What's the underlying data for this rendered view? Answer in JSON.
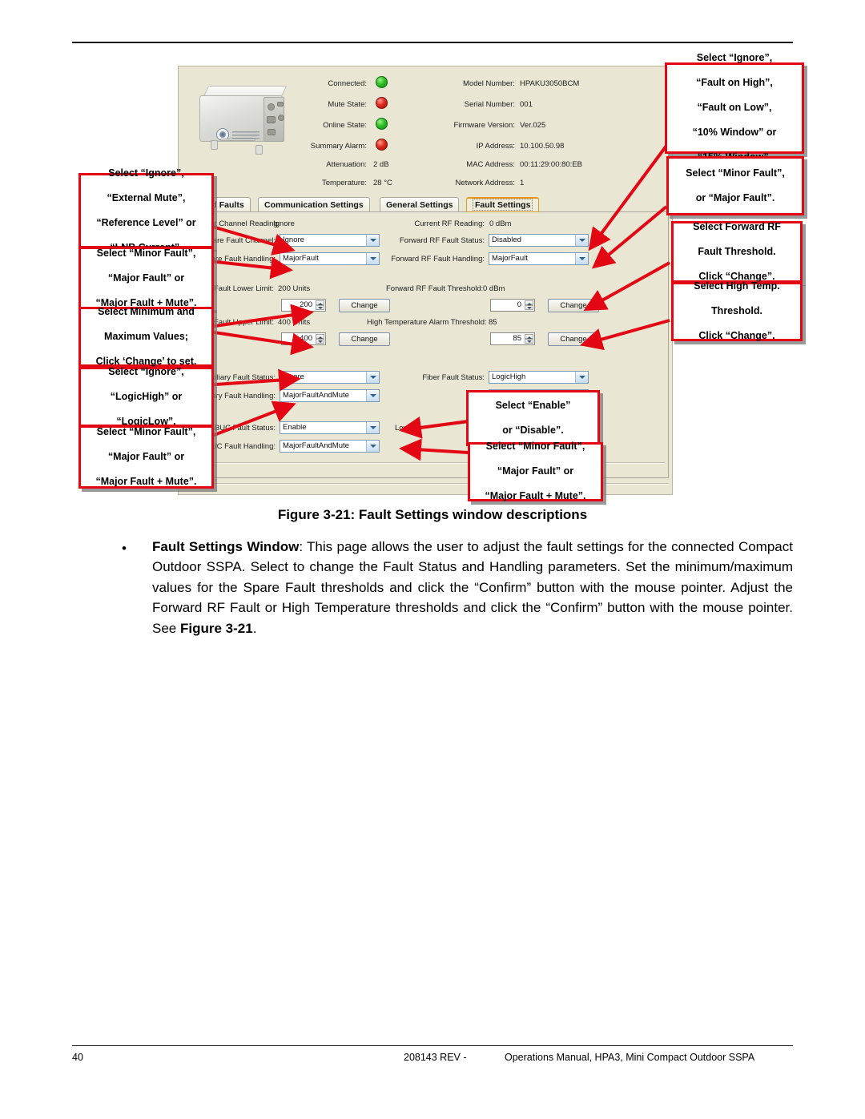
{
  "page": {
    "number": "40",
    "doc_number": "208143 REV -",
    "manual": "Operations Manual, HPA3, Mini Compact Outdoor SSPA"
  },
  "caption": "Figure 3-21: Fault Settings window descriptions",
  "body": {
    "lead": "Fault Settings Window",
    "text": ": This page allows the user to adjust the fault settings for the connected Compact Outdoor SSPA. Select to change the Fault Status and Handling parameters. Set the minimum/maximum values for the Spare Fault thresholds and click the “Confirm” button with the mouse pointer. Adjust the Forward RF Fault or High Temperature thresholds and click the “Confirm” button with the mouse pointer. See ",
    "see_figure": "Figure 3-21",
    "period": "."
  },
  "app": {
    "status_left": [
      {
        "label": "Connected:",
        "type": "led",
        "value": "green"
      },
      {
        "label": "Mute State:",
        "type": "led",
        "value": "red"
      },
      {
        "label": "Online State:",
        "type": "led",
        "value": "green"
      },
      {
        "label": "Summary Alarm:",
        "type": "led",
        "value": "red"
      },
      {
        "label": "Attenuation:",
        "type": "text",
        "value": "2 dB"
      },
      {
        "label": "Temperature:",
        "type": "text",
        "value": "28 °C"
      }
    ],
    "status_right": [
      {
        "label": "Model Number:",
        "value": "HPAKU3050BCM"
      },
      {
        "label": "Serial Number:",
        "value": "001"
      },
      {
        "label": "Firmware Version:",
        "value": "Ver.025"
      },
      {
        "label": "IP Address:",
        "value": "10.100.50.98"
      },
      {
        "label": "MAC Address:",
        "value": "00:11:29:00:80:EB"
      },
      {
        "label": "Network Address:",
        "value": "1"
      }
    ],
    "tabs": [
      {
        "label": "us and Faults",
        "selected": false
      },
      {
        "label": "Communication Settings",
        "selected": false
      },
      {
        "label": "General Settings",
        "selected": false
      },
      {
        "label": "Fault Settings",
        "selected": true
      }
    ],
    "fault_settings": {
      "left": {
        "current_channel_reading_label": "Current Channel Reading:",
        "current_channel_reading_value": "Ignore",
        "spare_fault_channel_label": "Spare Fault Channel:",
        "spare_fault_channel_value": "Ignore",
        "spare_fault_handling_label": "Spare Fault Handling:",
        "spare_fault_handling_value": "MajorFault",
        "spare_lower_label": "Spare Fault Lower Limit:",
        "spare_lower_value": "200 Units",
        "spare_lower_spin": "200",
        "spare_lower_button": "Change",
        "spare_upper_label": "Spare Fault Upper Limit:",
        "spare_upper_value": "400 Units",
        "spare_upper_spin": "400",
        "spare_upper_button": "Change",
        "aux_status_label": "Auxiliary Fault Status:",
        "aux_status_value": "Ignore",
        "aux_handling_label": "Auxiliary Fault Handling:",
        "aux_handling_value": "MajorFaultAndMute",
        "buc_status_label": "BUC Fault Status:",
        "buc_status_value": "Enable",
        "buc_handling_label": "BUC Fault Handling:",
        "buc_handling_value": "MajorFaultAndMute"
      },
      "right": {
        "current_rf_label": "Current RF Reading:",
        "current_rf_value": "0 dBm",
        "fwd_status_label": "Forward RF Fault Status:",
        "fwd_status_value": "Disabled",
        "fwd_handling_label": "Forward RF Fault Handling:",
        "fwd_handling_value": "MajorFault",
        "fwd_threshold_label": "Forward RF Fault Threshold:",
        "fwd_threshold_value": "0 dBm",
        "fwd_threshold_spin": "0",
        "fwd_threshold_button": "Change",
        "high_temp_label": "High Temperature Alarm Threshold:",
        "high_temp_value": "85",
        "high_temp_spin": "85",
        "high_temp_button": "Change",
        "fiber_status_label": "Fiber Fault Status:",
        "fiber_status_value": "LogicHigh",
        "low_current_label": "Low Cu"
      }
    }
  },
  "callouts": {
    "c1": "Select “Ignore”, “Fault on High”, “Fault on Low”, “10% Window” or “15% Window”.",
    "c1_lines": [
      "Select “Ignore”,",
      "“Fault on High”,",
      "“Fault on Low”,",
      "“10% Window” or",
      "“15% Window”."
    ],
    "c2_lines": [
      "Select “Minor Fault”,",
      "or “Major Fault”."
    ],
    "c3_lines": [
      "Select Forward RF",
      "Fault Threshold.",
      "Click “Change”."
    ],
    "c4_lines": [
      "Select High Temp.",
      "Threshold.",
      "Click “Change”."
    ],
    "c5_lines": [
      "Select “Ignore”,",
      "“External Mute”,",
      "“Reference Level” or",
      "“LNB Current”."
    ],
    "c6_lines": [
      "Select “Minor Fault”,",
      "“Major Fault” or",
      "“Major Fault + Mute”."
    ],
    "c7_lines": [
      "Select Minimum and",
      "Maximum Values;",
      "Click ‘Change’ to set."
    ],
    "c8_lines": [
      "Select “Ignore”,",
      "“LogicHigh” or",
      "“LogicLow”."
    ],
    "c9_lines": [
      "Select “Minor Fault”,",
      "“Major Fault” or",
      "“Major Fault + Mute”."
    ],
    "c10_lines": [
      "Select “Enable”",
      "or “Disable”."
    ],
    "c11_lines": [
      "Select “Minor Fault”,",
      "“Major Fault” or",
      "“Major Fault + Mute”."
    ]
  },
  "colors": {
    "callout_border": "#e30613",
    "app_background": "#e9e6d4",
    "led_green": "#2fbe25",
    "led_red": "#e02b20",
    "tab_selected": "#e8951f"
  }
}
